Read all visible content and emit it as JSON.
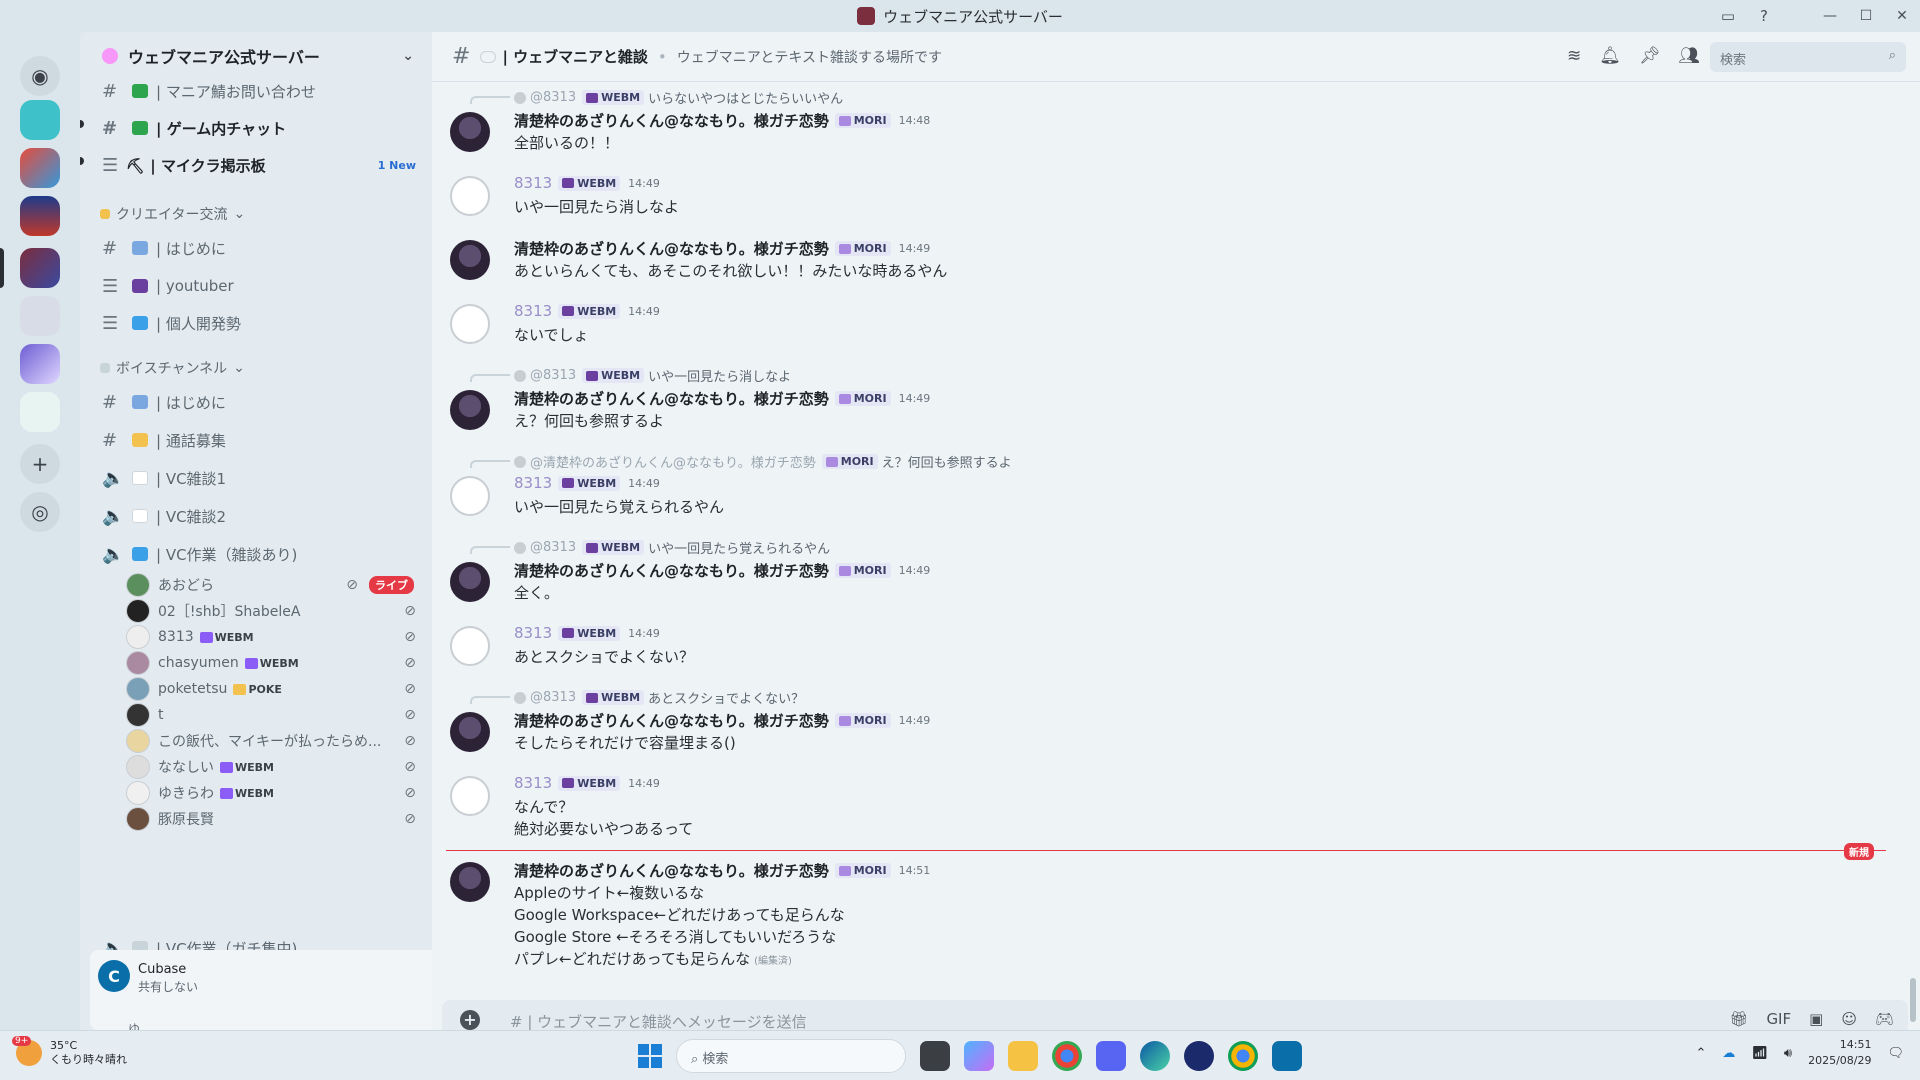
{
  "window": {
    "title": "ウェブマニア公式サーバー",
    "icons": [
      "inbox-icon",
      "help-icon"
    ],
    "controls": [
      "minimize",
      "maximize",
      "close"
    ]
  },
  "server": {
    "name": "ウェブマニア公式サーバー"
  },
  "sidebar": {
    "channels_top": [
      {
        "name": "| マニア鯖お問い合わせ",
        "icon": "hash-icon",
        "emoji_color": "#2da44e",
        "unread": false
      },
      {
        "name": "| ゲーム内チャット",
        "icon": "hash-icon",
        "emoji_color": "#2da44e",
        "unread": true
      },
      {
        "name": "⛏ | マイクラ掲示板",
        "icon": "forum-icon",
        "emoji_color": "",
        "unread": true,
        "badge": "1 New"
      }
    ],
    "categories": [
      {
        "name": "クリエイター交流",
        "channels": [
          {
            "name": "| はじめに",
            "icon": "hash-icon",
            "emoji_color": "#7aa7e0"
          },
          {
            "name": "| youtuber",
            "icon": "forum-icon",
            "emoji_color": "#6b3fa0"
          },
          {
            "name": "| 個人開発勢",
            "icon": "forum-icon",
            "emoji_color": "#3aa0e8"
          }
        ]
      },
      {
        "name": "ボイスチャンネル",
        "channels": [
          {
            "name": "| はじめに",
            "icon": "hash-icon",
            "emoji_color": "#7aa7e0"
          },
          {
            "name": "| 通話募集",
            "icon": "hash-icon",
            "emoji_color": "#f2c14e"
          },
          {
            "name": "| VC雑談1",
            "icon": "speaker-icon",
            "emoji_color": "#ffffff"
          },
          {
            "name": "| VC雑談2",
            "icon": "speaker-icon",
            "emoji_color": "#ffffff"
          },
          {
            "name": "| VC作業（雑談あり)",
            "icon": "speaker-icon",
            "emoji_color": "#3aa0e8"
          }
        ]
      }
    ],
    "voice_users": [
      {
        "name": "あおどら",
        "badge": "",
        "live": "ライブ",
        "avatar": "#5b8f5e"
      },
      {
        "name": "02［!shb］ShabeleA",
        "badge": "",
        "live": "",
        "avatar": "#222222"
      },
      {
        "name": "8313",
        "badge": "WEBM",
        "live": "",
        "avatar": "#eeeeee"
      },
      {
        "name": "chasyumen",
        "badge": "WEBM",
        "live": "",
        "avatar": "#a98aa0"
      },
      {
        "name": "poketetsu",
        "badge": "POKE",
        "live": "",
        "avatar": "#7aa0b8"
      },
      {
        "name": "t",
        "badge": "",
        "live": "",
        "avatar": "#333333"
      },
      {
        "name": "この飯代、マイキーが払ったらめ...",
        "badge": "",
        "live": "",
        "avatar": "#e8d5a0"
      },
      {
        "name": "ななしい",
        "badge": "WEBM",
        "live": "",
        "avatar": "#dddddd"
      },
      {
        "name": "ゆきらわ",
        "badge": "WEBM",
        "live": "",
        "avatar": "#f0f0f0"
      },
      {
        "name": "豚原長賢",
        "badge": "",
        "live": "",
        "avatar": "#6b5040"
      }
    ],
    "last_channel": "| VC作業（ガチ集中)",
    "activity": {
      "app": "Cubase",
      "status": "共有しない"
    },
    "user_partial": "ゆ"
  },
  "chat": {
    "channel_name": "| ウェブマニアと雑談",
    "topic": "ウェブマニアとテキスト雑談する場所です",
    "search_placeholder": "検索",
    "composer_placeholder": "| ウェブマニアと雑談へメッセージを送信",
    "new_label": "新規",
    "messages": [
      {
        "reply": {
          "name": "@8313",
          "tag": "WEBM",
          "text": "いらないやつはとじたらいいやん"
        },
        "author": "清楚枠のあざりんくん@ななもり。様ガチ恋勢",
        "tag": "MORI",
        "time": "14:48",
        "lines": [
          "全部いるの！！"
        ],
        "type": "kiyo"
      },
      {
        "author": "8313",
        "tag": "WEBM",
        "time": "14:49",
        "lines": [
          "いや一回見たら消しなよ"
        ],
        "type": "8313"
      },
      {
        "author": "清楚枠のあざりんくん@ななもり。様ガチ恋勢",
        "tag": "MORI",
        "time": "14:49",
        "lines": [
          "あといらんくても、あそこのそれ欲しい！！みたいな時あるやん"
        ],
        "type": "kiyo"
      },
      {
        "author": "8313",
        "tag": "WEBM",
        "time": "14:49",
        "lines": [
          "ないでしょ"
        ],
        "type": "8313"
      },
      {
        "reply": {
          "name": "@8313",
          "tag": "WEBM",
          "text": "いや一回見たら消しなよ"
        },
        "author": "清楚枠のあざりんくん@ななもり。様ガチ恋勢",
        "tag": "MORI",
        "time": "14:49",
        "lines": [
          "え？何回も参照するよ"
        ],
        "type": "kiyo"
      },
      {
        "reply": {
          "name": "@清楚枠のあざりんくん@ななもり。様ガチ恋勢",
          "tag": "MORI",
          "text": "え？何回も参照するよ"
        },
        "author": "8313",
        "tag": "WEBM",
        "time": "14:49",
        "lines": [
          "いや一回見たら覚えられるやん"
        ],
        "type": "8313"
      },
      {
        "reply": {
          "name": "@8313",
          "tag": "WEBM",
          "text": "いや一回見たら覚えられるやん"
        },
        "author": "清楚枠のあざりんくん@ななもり。様ガチ恋勢",
        "tag": "MORI",
        "time": "14:49",
        "lines": [
          "全く。"
        ],
        "type": "kiyo"
      },
      {
        "author": "8313",
        "tag": "WEBM",
        "time": "14:49",
        "lines": [
          "あとスクショでよくない？"
        ],
        "type": "8313"
      },
      {
        "reply": {
          "name": "@8313",
          "tag": "WEBM",
          "text": "あとスクショでよくない？"
        },
        "author": "清楚枠のあざりんくん@ななもり。様ガチ恋勢",
        "tag": "MORI",
        "time": "14:49",
        "lines": [
          "そしたらそれだけで容量埋まる()"
        ],
        "type": "kiyo"
      },
      {
        "author": "8313",
        "tag": "WEBM",
        "time": "14:49",
        "lines": [
          "なんで？",
          "絶対必要ないやつあるって"
        ],
        "type": "8313"
      },
      {
        "author": "清楚枠のあざりんくん@ななもり。様ガチ恋勢",
        "tag": "MORI",
        "time": "14:51",
        "lines": [
          "Appleのサイト←複数いるな",
          "Google Workspace←どれだけあっても足らんな",
          "Google Store ←そろそろ消してもいいだろうな",
          "パプレ←どれだけあっても足らんな"
        ],
        "edited": "(編集済)",
        "type": "kiyo"
      }
    ]
  },
  "taskbar": {
    "weather_temp": "35°C",
    "weather_text": "くもり時々晴れ",
    "weather_badge": "9+",
    "search_placeholder": "検索",
    "time": "14:51",
    "date": "2025/08/29"
  },
  "colors": {
    "accent_new": "#e53945",
    "link_blue": "#2a6ed3",
    "mori_tag": "#e4e6f6"
  }
}
